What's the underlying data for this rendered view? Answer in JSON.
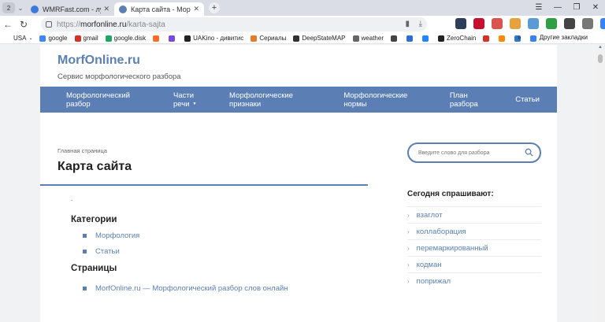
{
  "browser": {
    "tab_counter": "2",
    "tabs": [
      {
        "title": "WMRFast.com - лучшее м",
        "active": false
      },
      {
        "title": "Карта сайта - Морфо",
        "active": true
      }
    ],
    "new_tab": "+",
    "window_controls": [
      "☰",
      "—",
      "❐",
      "✕"
    ],
    "url": {
      "protocol": "https://",
      "host": "morfonline.ru",
      "path": "/karta-sajta"
    },
    "bookmarks": [
      {
        "label": "USA",
        "color": "#ffffff"
      },
      {
        "label": "google",
        "color": "#4285f4"
      },
      {
        "label": "gmail",
        "color": "#d93025"
      },
      {
        "label": "google.disk",
        "color": "#1fa463"
      },
      {
        "label": "",
        "color": "#ff6d2d"
      },
      {
        "label": "",
        "color": "#7a4bd6"
      },
      {
        "label": "UAKino - дивитис",
        "color": "#222222"
      },
      {
        "label": "Сериалы",
        "color": "#e57c2b"
      },
      {
        "label": "DeepStateMAP",
        "color": "#333333"
      },
      {
        "label": "weather",
        "color": "#666666"
      },
      {
        "label": "",
        "color": "#444444"
      },
      {
        "label": "",
        "color": "#2f6ecf"
      },
      {
        "label": "",
        "color": "#1f86ff"
      },
      {
        "label": "ZeroChain",
        "color": "#222222"
      },
      {
        "label": "",
        "color": "#d93025"
      },
      {
        "label": "",
        "color": "#ff8800"
      },
      {
        "label": "",
        "color": "#2a78c9"
      },
      {
        "label": "",
        "color": "#3b82f6"
      }
    ],
    "bookmarks_more": "»",
    "bookmarks_other": "Другие закладки"
  },
  "site": {
    "logo": "MorfOnline.ru",
    "tagline": "Сервис морфологического разбора",
    "nav": [
      {
        "label": "Морфологический разбор"
      },
      {
        "label": "Части речи"
      },
      {
        "label": "Морфологические признаки"
      },
      {
        "label": "Морфологические нормы"
      },
      {
        "label": "План разбора"
      },
      {
        "label": "Статьи"
      }
    ],
    "breadcrumb": "Главная страница",
    "page_title": "Карта сайта",
    "dot": ".",
    "sections": [
      {
        "heading": "Категории",
        "links": [
          "Морфология",
          "Статьи"
        ]
      },
      {
        "heading": "Страницы",
        "links": [
          "MorfOnline.ru — Морфологический разбор слов онлайн"
        ]
      }
    ],
    "search_placeholder": "Введите слово для разбора",
    "sidebar_heading": "Сегодня спрашивают:",
    "sidebar_links": [
      "взаглот",
      "коллаборация",
      "перемаркированный",
      "кодман",
      "поприжал"
    ]
  }
}
